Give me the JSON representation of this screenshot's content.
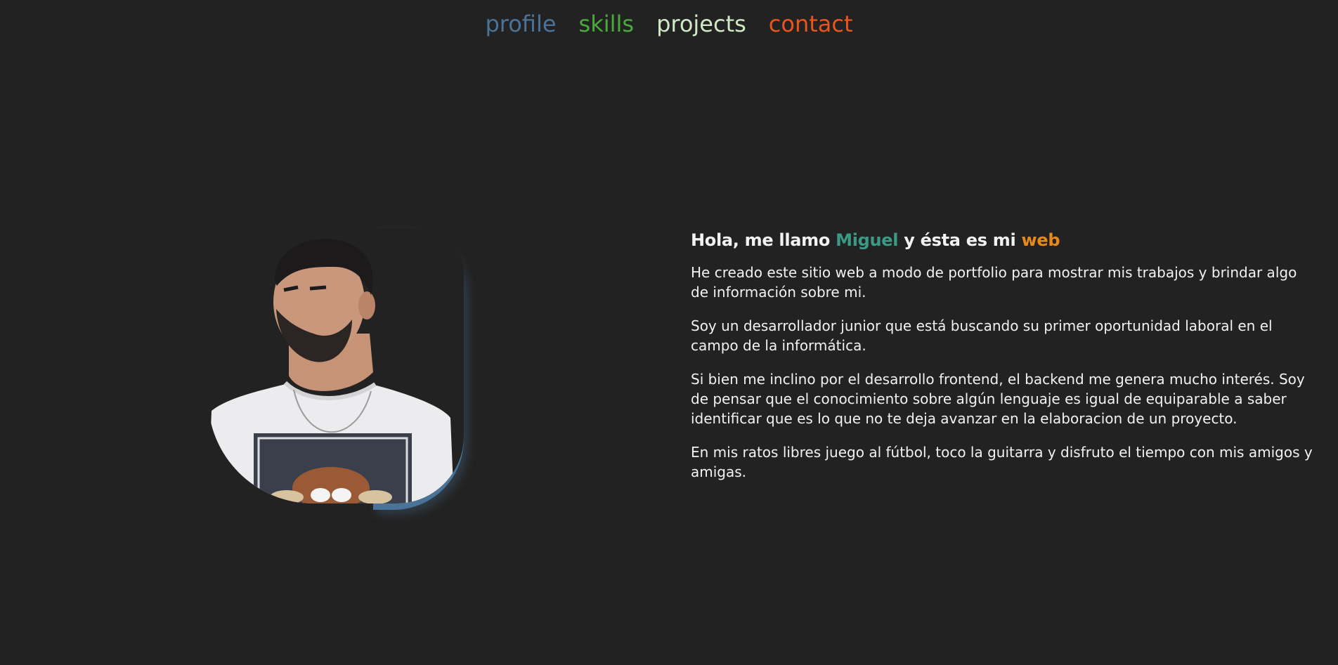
{
  "nav": {
    "items": [
      {
        "label": "profile",
        "color": "#4a7397"
      },
      {
        "label": "skills",
        "color": "#4aab3c"
      },
      {
        "label": "projects",
        "color": "#cfe8c5"
      },
      {
        "label": "contact",
        "color": "#e8561e"
      }
    ]
  },
  "hero": {
    "photo_icon": "portrait-photo",
    "heading": {
      "prefix": "Hola, me llamo ",
      "name": "Miguel",
      "name_color": "#3a9a87",
      "middle": " y ésta es mi ",
      "web": "web",
      "web_color": "#e88a1a"
    },
    "paragraphs": [
      "He creado este sitio web a modo de portfolio para mostrar mis trabajos y brindar algo de información sobre mi.",
      "Soy un desarrollador junior que está buscando su primer oportunidad laboral en el campo de la informática.",
      "Si bien me inclino por el desarrollo frontend, el backend me genera mucho interés. Soy de pensar que el conocimiento sobre algún lenguaje es igual de equiparable a saber identificar que es lo que no te deja avanzar en la elaboracion de un proyecto.",
      "En mis ratos libres juego al fútbol, toco la guitarra y disfruto el tiempo con mis amigos y amigas."
    ]
  }
}
